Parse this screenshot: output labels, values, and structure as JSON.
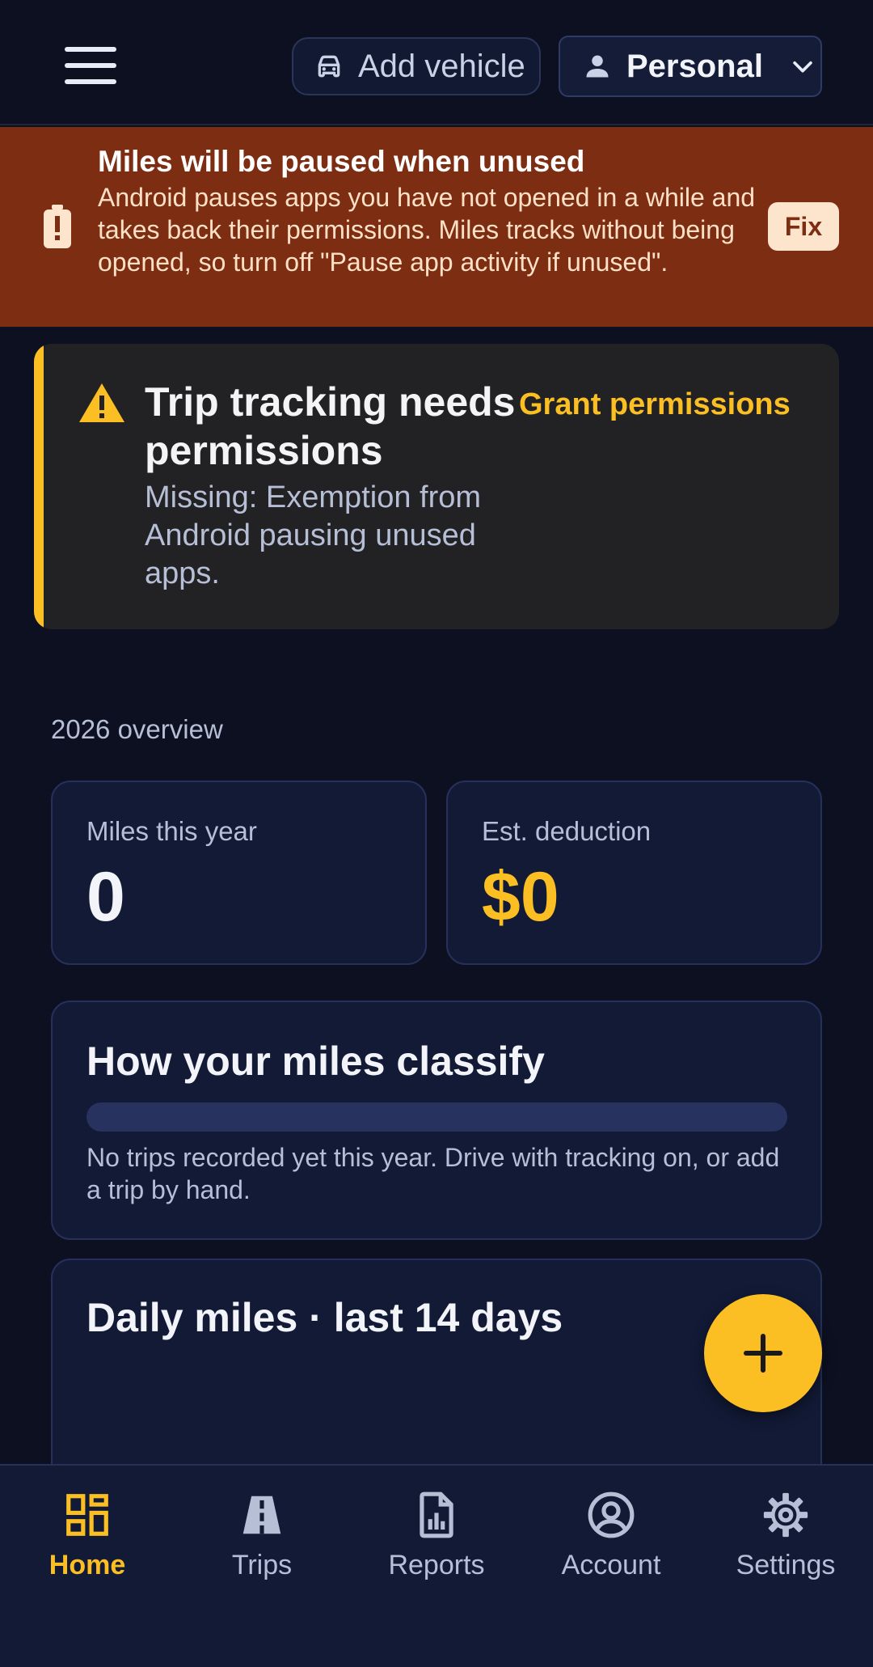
{
  "topbar": {
    "menu_icon": "hamburger-menu-icon",
    "add_vehicle_label": "Add vehicle",
    "add_vehicle_icon": "car-icon",
    "profile_label": "Personal",
    "profile_icon": "person-icon"
  },
  "pause_banner": {
    "icon": "battery-alert-icon",
    "title": "Miles will be paused when unused",
    "body": "Android pauses apps you have not opened in a while and takes back their permissions. Miles tracks without being opened, so turn off \"Pause app activity if unused\".",
    "fix_label": "Fix",
    "background": "#7c2d12"
  },
  "permissions_card": {
    "icon": "warning-icon",
    "title": "Trip tracking needs permissions",
    "description": "Missing: Exemption from Android pausing unused apps.",
    "grant_label": "Grant permissions",
    "accent": "#fbbf24"
  },
  "overview": {
    "label": "2026 overview",
    "miles_label": "Miles this year",
    "miles_value": "0",
    "deduction_label": "Est. deduction",
    "deduction_value": "$0"
  },
  "classify": {
    "title": "How your miles classify",
    "note": "No trips recorded yet this year. Drive with tracking on, or add a trip by hand."
  },
  "daily": {
    "title": "Daily miles · last 14 days"
  },
  "fab": {
    "icon": "plus-icon"
  },
  "nav": [
    {
      "label": "Home",
      "icon": "dashboard-icon",
      "active": true
    },
    {
      "label": "Trips",
      "icon": "road-icon",
      "active": false
    },
    {
      "label": "Reports",
      "icon": "report-icon",
      "active": false
    },
    {
      "label": "Account",
      "icon": "account-circle-icon",
      "active": false
    },
    {
      "label": "Settings",
      "icon": "gear-icon",
      "active": false
    }
  ],
  "colors": {
    "background": "#0c1020",
    "card": "#121a36",
    "accent": "#fbbf24",
    "text_muted": "#b7bfd6"
  }
}
